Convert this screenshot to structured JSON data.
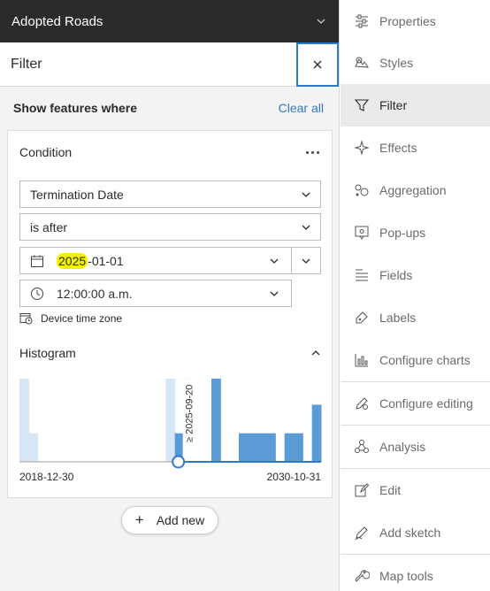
{
  "layer": {
    "title": "Adopted Roads"
  },
  "filter": {
    "title": "Filter",
    "show_features": "Show features where",
    "clear_all": "Clear all",
    "condition": {
      "title": "Condition",
      "field": "Termination Date",
      "operator": "is after",
      "date_highlight": "2025",
      "date_rest": "-01-01",
      "time": "12:00:00 a.m.",
      "timezone": "Device time zone"
    },
    "histogram": {
      "title": "Histogram",
      "min_label": "2018-12-30",
      "max_label": "2030-10-31",
      "marker_label": "≥ 2025-09-20"
    },
    "add_new": "Add new"
  },
  "chart_data": {
    "type": "bar",
    "x_range": [
      "2018-12-30",
      "2030-10-31"
    ],
    "selected_from": "2025-01-01",
    "marker_label": "≥ 2025-09-20",
    "bins": [
      {
        "level": 0.99,
        "selected": false
      },
      {
        "level": 0.34,
        "selected": false
      },
      {
        "level": 0,
        "selected": false
      },
      {
        "level": 0,
        "selected": false
      },
      {
        "level": 0,
        "selected": false
      },
      {
        "level": 0,
        "selected": false
      },
      {
        "level": 0,
        "selected": false
      },
      {
        "level": 0,
        "selected": false
      },
      {
        "level": 0,
        "selected": false
      },
      {
        "level": 0,
        "selected": false
      },
      {
        "level": 0,
        "selected": false
      },
      {
        "level": 0,
        "selected": false
      },
      {
        "level": 0,
        "selected": false
      },
      {
        "level": 0,
        "selected": false
      },
      {
        "level": 0,
        "selected": false
      },
      {
        "level": 0,
        "selected": false
      },
      {
        "level": 0.99,
        "selected": false
      },
      {
        "level": 0.34,
        "selected": true
      },
      {
        "level": 0.99,
        "selected": true
      },
      {
        "level": 0,
        "selected": true
      },
      {
        "level": 0,
        "selected": true
      },
      {
        "level": 0.99,
        "selected": true
      },
      {
        "level": 0,
        "selected": true
      },
      {
        "level": 0,
        "selected": true
      },
      {
        "level": 0.34,
        "selected": true
      },
      {
        "level": 0.34,
        "selected": true
      },
      {
        "level": 0.34,
        "selected": true
      },
      {
        "level": 0.34,
        "selected": true
      },
      {
        "level": 0,
        "selected": true
      },
      {
        "level": 0.34,
        "selected": true
      },
      {
        "level": 0.34,
        "selected": true
      },
      {
        "level": 0,
        "selected": true
      },
      {
        "level": 0.68,
        "selected": true
      }
    ],
    "colors": {
      "selected": "#5b9bd5",
      "unselected": "#d6e6f4"
    }
  },
  "nav": {
    "items": [
      {
        "label": "Properties",
        "icon": "sliders-icon"
      },
      {
        "label": "Styles",
        "icon": "styles-icon"
      },
      {
        "label": "Filter",
        "icon": "filter-icon",
        "active": true
      },
      {
        "label": "Effects",
        "icon": "sparkle-icon"
      },
      {
        "label": "Aggregation",
        "icon": "aggregation-icon"
      },
      {
        "label": "Pop-ups",
        "icon": "popup-icon"
      },
      {
        "label": "Fields",
        "icon": "fields-icon"
      },
      {
        "label": "Labels",
        "icon": "label-icon"
      },
      {
        "label": "Configure charts",
        "icon": "chart-icon"
      },
      {
        "label": "Configure editing",
        "icon": "edit-config-icon"
      },
      {
        "label": "Analysis",
        "icon": "analysis-icon"
      },
      {
        "label": "Edit",
        "icon": "edit-icon"
      },
      {
        "label": "Add sketch",
        "icon": "sketch-icon"
      },
      {
        "label": "Map tools",
        "icon": "wrench-icon"
      }
    ]
  },
  "colors": {
    "accent": "#2f7ac7",
    "header_bg": "#2b2b2b",
    "highlight": "#f4f100"
  }
}
